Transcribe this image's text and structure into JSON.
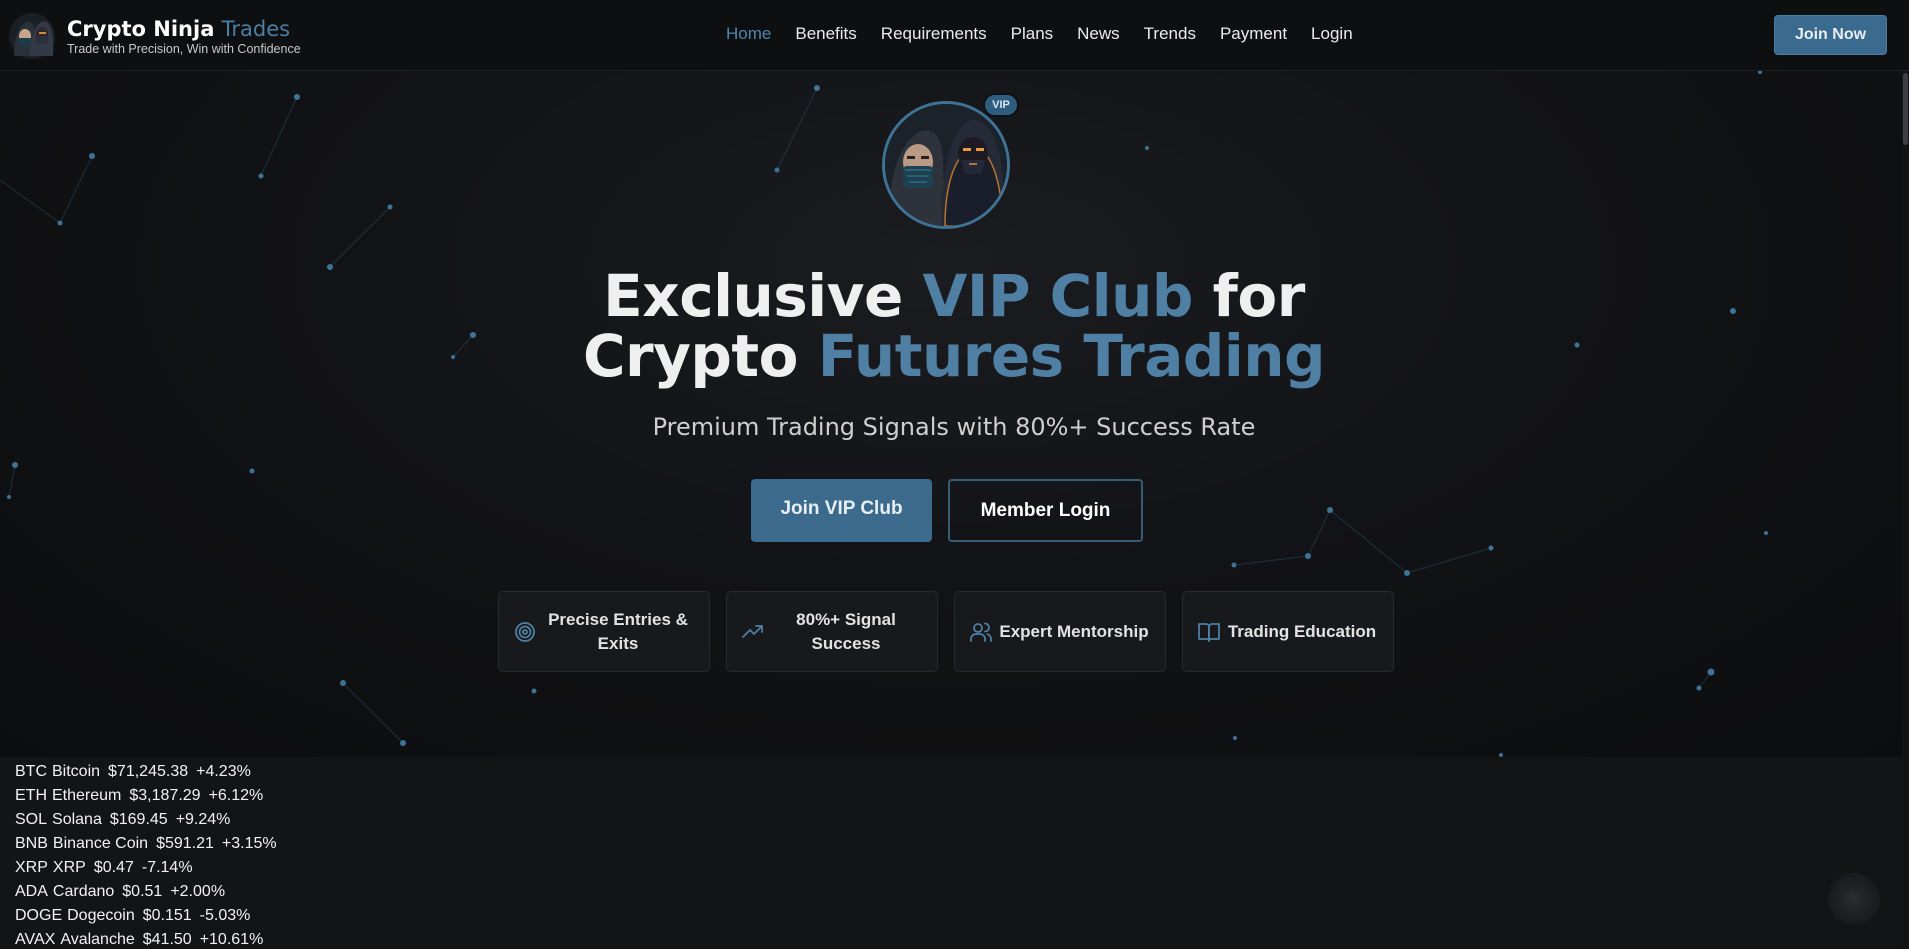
{
  "header": {
    "brand_name": "Crypto Ninja",
    "brand_accent": "Trades",
    "tagline": "Trade with Precision, Win with Confidence",
    "nav": [
      {
        "label": "Home",
        "active": true
      },
      {
        "label": "Benefits"
      },
      {
        "label": "Requirements"
      },
      {
        "label": "Plans"
      },
      {
        "label": "News"
      },
      {
        "label": "Trends"
      },
      {
        "label": "Payment"
      },
      {
        "label": "Login"
      }
    ],
    "join_now": "Join Now"
  },
  "hero": {
    "vip_badge": "VIP",
    "title_part1": "Exclusive ",
    "title_accent1": "VIP Club",
    "title_part2": " for",
    "title_part3": "Crypto ",
    "title_accent2": "Futures Trading",
    "subtitle": "Premium Trading Signals with 80%+ Success Rate",
    "join_vip_button": "Join VIP Club",
    "member_login_button": "Member Login"
  },
  "features": [
    {
      "icon": "target-icon",
      "label": "Precise Entries & Exits"
    },
    {
      "icon": "trending-up-icon",
      "label": "80%+ Signal Success"
    },
    {
      "icon": "users-icon",
      "label": "Expert Mentorship"
    },
    {
      "icon": "book-open-icon",
      "label": "Trading Education"
    }
  ],
  "ticker": [
    {
      "symbol": "BTC",
      "name": "Bitcoin",
      "price": "$71,245.38",
      "change": "+4.23%"
    },
    {
      "symbol": "ETH",
      "name": "Ethereum",
      "price": "$3,187.29",
      "change": "+6.12%"
    },
    {
      "symbol": "SOL",
      "name": "Solana",
      "price": "$169.45",
      "change": "+9.24%"
    },
    {
      "symbol": "BNB",
      "name": "Binance Coin",
      "price": "$591.21",
      "change": "+3.15%"
    },
    {
      "symbol": "XRP",
      "name": "XRP",
      "price": "$0.47",
      "change": "-7.14%"
    },
    {
      "symbol": "ADA",
      "name": "Cardano",
      "price": "$0.51",
      "change": "+2.00%"
    },
    {
      "symbol": "DOGE",
      "name": "Dogecoin",
      "price": "$0.151",
      "change": "-5.03%"
    },
    {
      "symbol": "AVAX",
      "name": "Avalanche",
      "price": "$41.50",
      "change": "+10.61%"
    }
  ],
  "colors": {
    "accent": "#4f7fa2",
    "button": "#3b6a8c",
    "background": "#0c0d0f"
  }
}
